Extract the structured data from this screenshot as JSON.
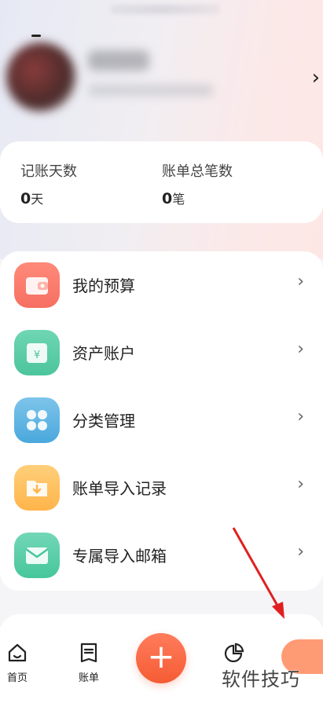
{
  "stats": {
    "days_label": "记账天数",
    "days_value": "0",
    "days_unit": "天",
    "bills_label": "账单总笔数",
    "bills_value": "0",
    "bills_unit": "笔"
  },
  "menu": {
    "items": [
      {
        "label": "我的预算",
        "icon": "wallet-icon"
      },
      {
        "label": "资产账户",
        "icon": "asset-icon"
      },
      {
        "label": "分类管理",
        "icon": "category-icon"
      },
      {
        "label": "账单导入记录",
        "icon": "import-folder-icon"
      },
      {
        "label": "专属导入邮箱",
        "icon": "mail-icon"
      }
    ]
  },
  "tabs": {
    "home": "首页",
    "bills": "账单"
  },
  "watermark": "软件技巧",
  "colors": {
    "accent": "#f55c34",
    "annotation_arrow": "#e02020"
  }
}
